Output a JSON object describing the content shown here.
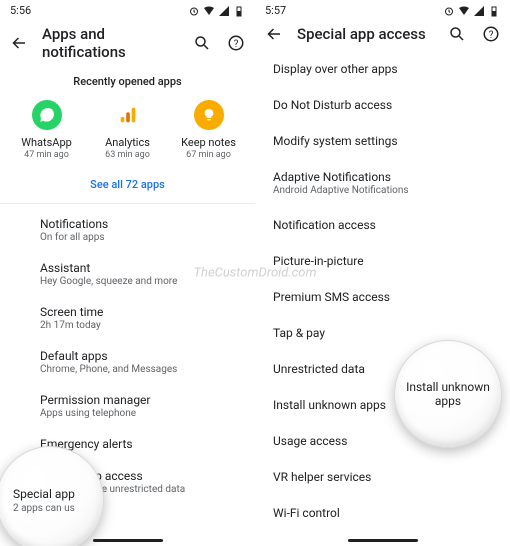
{
  "left": {
    "time": "5:56",
    "appbar_title": "Apps and notifications",
    "section_label": "Recently opened apps",
    "recent_apps": [
      {
        "name": "WhatsApp",
        "sub": "47 min ago",
        "color": "#25D366",
        "glyph": "phone"
      },
      {
        "name": "Analytics",
        "sub": "63 min ago",
        "color": "#F9AB00",
        "glyph": "bars"
      },
      {
        "name": "Keep notes",
        "sub": "67 min ago",
        "color": "#F9AB00",
        "glyph": "bulb"
      }
    ],
    "see_all": "See all 72 apps",
    "settings": [
      {
        "title": "Notifications",
        "sub": "On for all apps"
      },
      {
        "title": "Assistant",
        "sub": "Hey Google, squeeze and more"
      },
      {
        "title": "Screen time",
        "sub": "2h 17m today"
      },
      {
        "title": "Default apps",
        "sub": "Chrome, Phone, and Messages"
      },
      {
        "title": "Permission manager",
        "sub": "Apps using telephone"
      },
      {
        "title": "Emergency alerts",
        "sub": ""
      },
      {
        "title": "Special app access",
        "sub": "2 apps can use unrestricted data"
      }
    ],
    "magnifier": {
      "title": "Special app",
      "sub": "2 apps can us"
    }
  },
  "right": {
    "time": "5:57",
    "appbar_title": "Special app access",
    "items": [
      {
        "title": "Display over other apps"
      },
      {
        "title": "Do Not Disturb access"
      },
      {
        "title": "Modify system settings"
      },
      {
        "title": "Adaptive Notifications",
        "sub": "Android Adaptive Notifications"
      },
      {
        "title": "Notification access"
      },
      {
        "title": "Picture-in-picture"
      },
      {
        "title": "Premium SMS access"
      },
      {
        "title": "Tap & pay"
      },
      {
        "title": "Unrestricted data"
      },
      {
        "title": "Install unknown apps"
      },
      {
        "title": "Usage access"
      },
      {
        "title": "VR helper services"
      },
      {
        "title": "Wi-Fi control"
      }
    ],
    "magnifier": {
      "title": "Install unknown apps"
    }
  },
  "watermark": "TheCustomDroid.com"
}
